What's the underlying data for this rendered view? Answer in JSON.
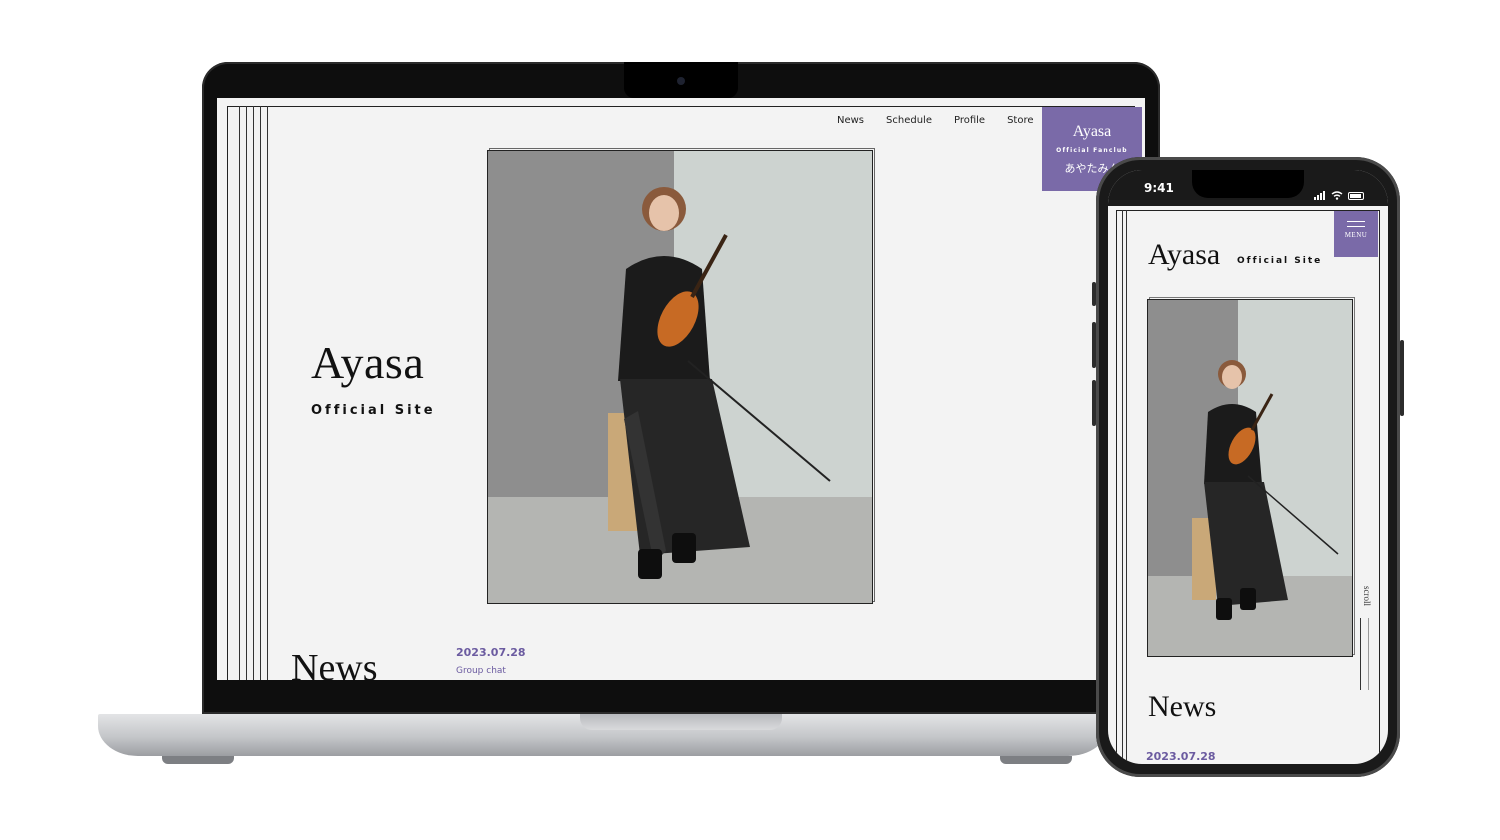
{
  "desktop": {
    "nav": [
      "News",
      "Schedule",
      "Profile",
      "Store"
    ],
    "site_title": "Ayasa",
    "site_subtitle": "Official Site",
    "fanclub": {
      "name": "Ayasa",
      "subtitle": "Official Fanclub",
      "japanese": "あやたみん"
    },
    "news": {
      "heading": "News",
      "date": "2023.07.28",
      "text": "Group chat"
    }
  },
  "mobile": {
    "status_time": "9:41",
    "menu_label": "MENU",
    "site_title": "Ayasa",
    "site_subtitle": "Official Site",
    "scroll_label": "scroll",
    "news_heading": "News",
    "news_date": "2023.07.28"
  },
  "colors": {
    "accent": "#7a6aa8",
    "accent_text": "#6b5ba0",
    "page_bg": "#f3f3f3"
  }
}
